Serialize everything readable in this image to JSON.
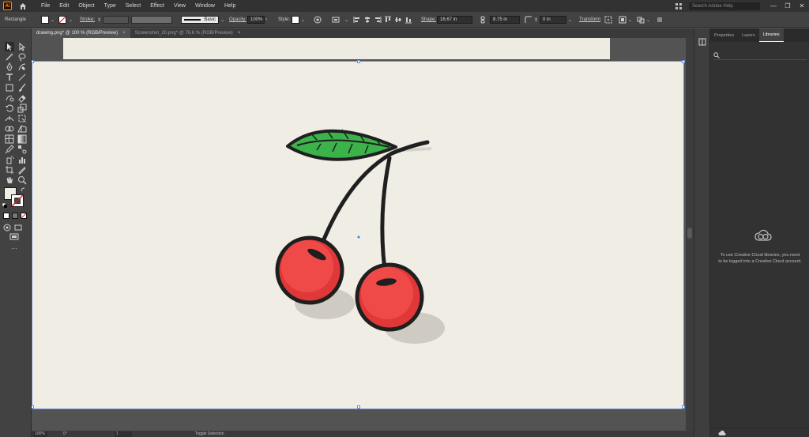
{
  "app": {
    "logo": "Ai",
    "menu": [
      "File",
      "Edit",
      "Object",
      "Type",
      "Select",
      "Effect",
      "View",
      "Window",
      "Help"
    ],
    "help_search_placeholder": "Search Adobe Help",
    "window_controls": [
      "—",
      "❐",
      "✕"
    ]
  },
  "controlbar": {
    "object_type": "Rectangle",
    "stroke_label": "Stroke:",
    "brush_label": "Basic",
    "opacity_label": "Opacity:",
    "opacity_value": "100%",
    "style_label": "Style:",
    "shape_label": "Shape:",
    "width_value": "16.67 in",
    "height_value": "8.75 in",
    "angle_value": "0 in",
    "transform_label": "Transform",
    "fill_color": "#ffffff"
  },
  "tabs": [
    {
      "label": "drawing.png* @ 100 % (RGB/Preview)",
      "active": true
    },
    {
      "label": "Screenshot_20.png* @ 76.6 % (RGB/Preview)",
      "active": false
    }
  ],
  "statusbar": {
    "zoom": "100%",
    "rotation": "0°",
    "artboard": "1",
    "status": "Toggle Selection"
  },
  "right_panel": {
    "tabs": [
      "Properties",
      "Layers",
      "Libraries"
    ],
    "active_tab": "Libraries",
    "message": "To use Creative Cloud libraries, you need to be logged into a Creative Cloud account."
  },
  "colors": {
    "accent": "#6b8fd6",
    "cherry_red": "#f04a48",
    "leaf_green": "#3bb34a"
  }
}
